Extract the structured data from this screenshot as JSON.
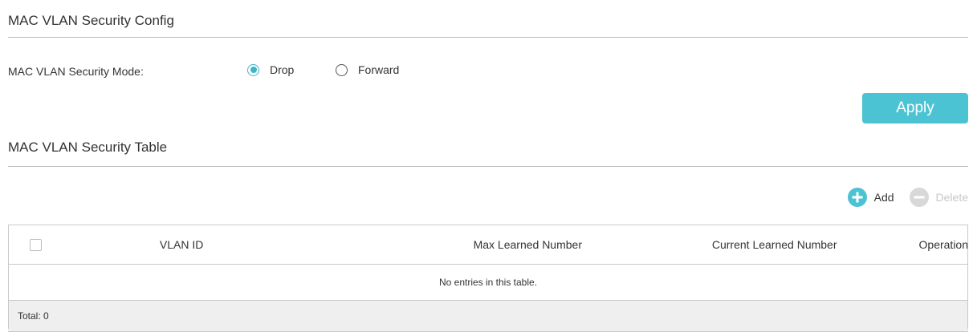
{
  "config_section": {
    "title": "MAC VLAN Security Config",
    "mode_label": "MAC VLAN Security Mode:",
    "options": [
      {
        "label": "Drop",
        "selected": true
      },
      {
        "label": "Forward",
        "selected": false
      }
    ],
    "apply_label": "Apply"
  },
  "table_section": {
    "title": "MAC VLAN Security Table",
    "add_label": "Add",
    "delete_label": "Delete",
    "columns": [
      "VLAN ID",
      "Max Learned Number",
      "Current Learned Number",
      "Operation"
    ],
    "empty_message": "No entries in this table.",
    "total_label": "Total: 0"
  },
  "colors": {
    "accent": "#4cc3d3",
    "disabled": "#d0d0d0",
    "footer_bg": "#efefef"
  },
  "icons": {
    "add": "plus-circle-icon",
    "delete": "minus-circle-icon"
  }
}
